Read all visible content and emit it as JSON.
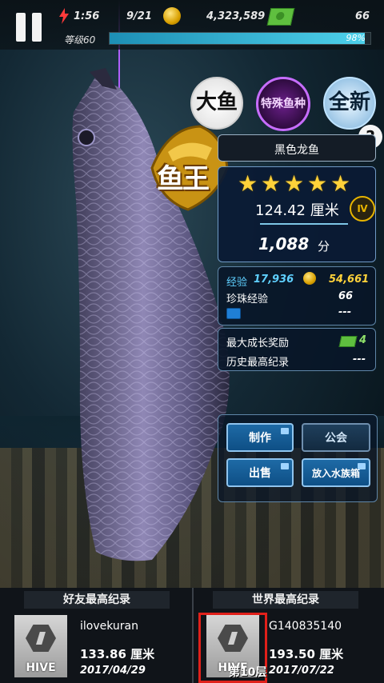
{
  "hud": {
    "time": "1:56",
    "catch_count": "9/21",
    "coins": "4,323,589",
    "cash": "66",
    "level": "等级60",
    "xp_percent": "98%",
    "xp_fraction": 0.98
  },
  "filters": {
    "big_fish": "大鱼",
    "special": "特殊鱼种",
    "all_new": "全新",
    "help": "?"
  },
  "emblem": {
    "text": "鱼王"
  },
  "fish": {
    "name": "黑色龙鱼",
    "stars": 5,
    "length": "124.42 厘米",
    "grade": "Ⅳ",
    "score": "1,088",
    "score_unit": "分"
  },
  "rewards": {
    "xp_label": "经验",
    "xp_value": "17,936",
    "coin_value": "54,661",
    "pearl_xp_label": "珍珠经验",
    "pearl_xp_value": "66",
    "blue_value": "---"
  },
  "growth": {
    "max_reward_label": "最大成长奖励",
    "max_reward_value": "4",
    "record_label": "历史最高纪录",
    "record_value": "---"
  },
  "buttons": {
    "craft": "制作",
    "guild": "公会",
    "sell": "出售",
    "aquarium": "放入水族箱"
  },
  "records": {
    "friend_title": "好友最高纪录",
    "world_title": "世界最高纪录",
    "friend": {
      "name": "ilovekuran",
      "length": "133.86 厘米",
      "date": "2017/04/29",
      "logo": "HIVE"
    },
    "world": {
      "name": "G140835140",
      "length": "193.50 厘米",
      "date": "2017/07/22",
      "logo": "HIVE",
      "floor": "第10层"
    }
  },
  "colors": {
    "accent": "#1e6aa6",
    "star": "#ffd23a",
    "highlight": "#e0201a"
  }
}
